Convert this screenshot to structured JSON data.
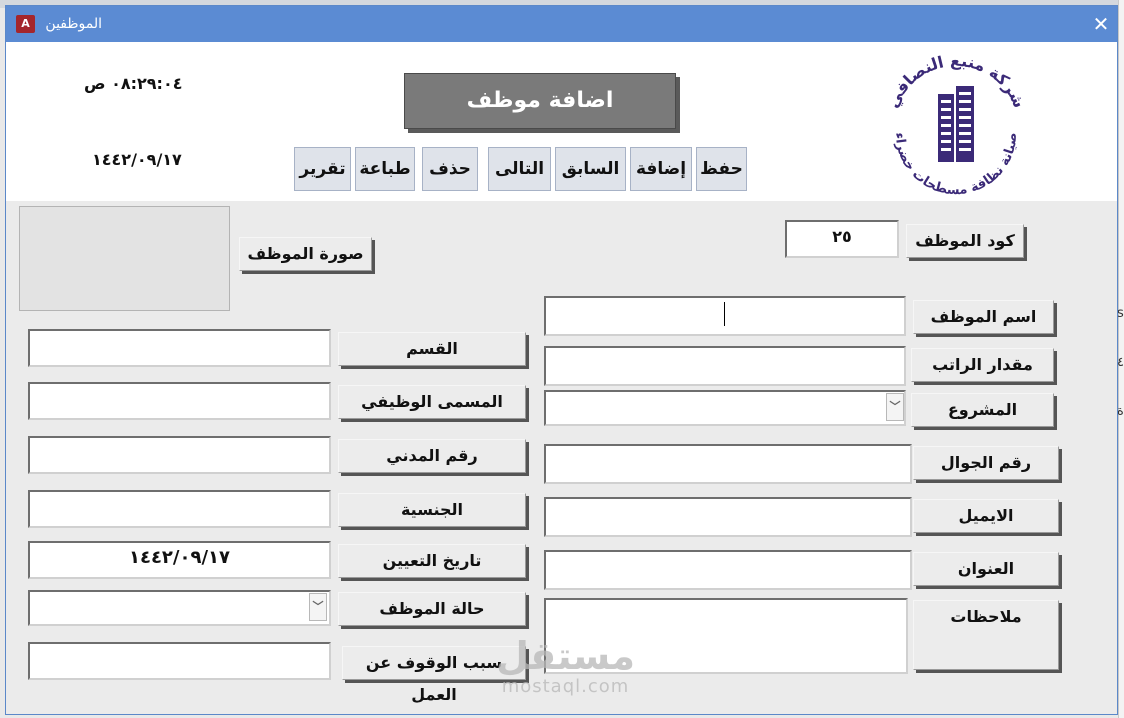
{
  "window": {
    "title": "الموظفين",
    "app_icon_text": "A",
    "close_symbol": "✕"
  },
  "header": {
    "time": "٠٨:٢٩:٠٤ ص",
    "date": "١٤٤٢/٠٩/١٧",
    "form_title": "اضافة موظف",
    "toolbar": {
      "save": "حفظ",
      "add": "إضافة",
      "previous": "السابق",
      "next": "التالى",
      "delete": "حذف",
      "print": "طباعة",
      "report": "تقرير"
    },
    "logo": {
      "top_text": "شركة منبع النصافي",
      "bottom_text": "صيانة نظافة مسطحات خضراء",
      "icon": "building-logo-icon",
      "color": "#3b2a78"
    }
  },
  "form": {
    "photo_label": "صورة الموظف",
    "employee_code": {
      "label": "كود الموظف",
      "value": "٢٥"
    },
    "employee_name": {
      "label": "اسم الموظف",
      "value": ""
    },
    "salary": {
      "label": "مقدار الراتب",
      "value": ""
    },
    "project": {
      "label": "المشروع",
      "value": ""
    },
    "mobile": {
      "label": "رقم الجوال",
      "value": ""
    },
    "email": {
      "label": "الايميل",
      "value": ""
    },
    "address": {
      "label": "العنوان",
      "value": ""
    },
    "notes": {
      "label": "ملاحظات",
      "value": ""
    },
    "department": {
      "label": "القسم",
      "value": ""
    },
    "job_title": {
      "label": "المسمى الوظيفي",
      "value": ""
    },
    "civil_id": {
      "label": "رقم المدني",
      "value": ""
    },
    "nationality": {
      "label": "الجنسية",
      "value": ""
    },
    "hire_date": {
      "label": "تاريخ التعيين",
      "value": "١٤٤٢/٠٩/١٧"
    },
    "status": {
      "label": "حالة الموظف",
      "value": ""
    },
    "stop_reason": {
      "label": "سبب الوقوف عن العمل",
      "value": ""
    }
  },
  "watermark": {
    "main": "مستقل",
    "sub": "mostaql.com"
  },
  "background": {
    "right_glyphs": [
      "s",
      "٤",
      "ة"
    ]
  },
  "colors": {
    "titlebar": "#5b8bd3",
    "title_box": "#7a7a7a",
    "toolbar_button": "#dfe3ea"
  }
}
